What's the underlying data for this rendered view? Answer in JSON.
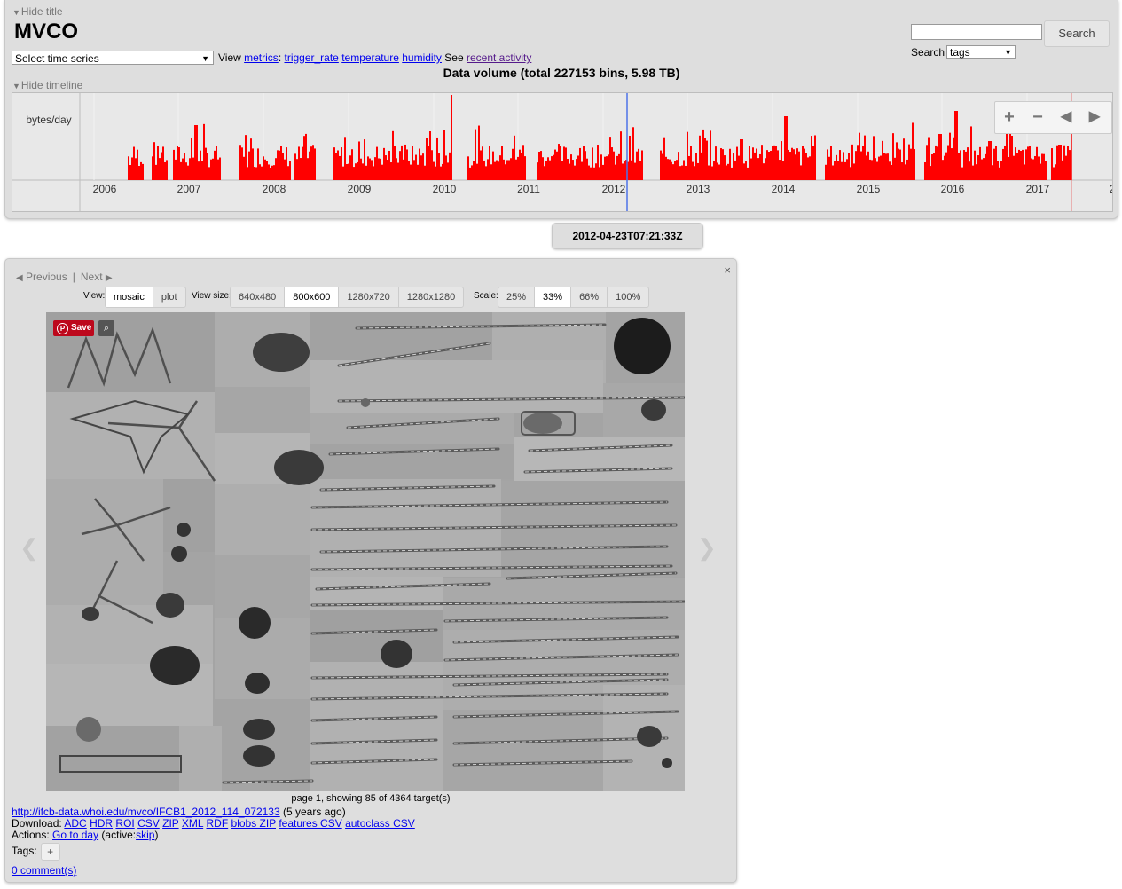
{
  "header": {
    "hide_title_label": "Hide title",
    "title": "MVCO",
    "time_series_select": "Select time series",
    "view_text": "View",
    "metrics_link": "metrics",
    "trigger_rate_link": "trigger_rate",
    "temperature_link": "temperature",
    "humidity_link": "humidity",
    "see_text": "See",
    "recent_activity_link": "recent activity",
    "volume_title": "Data volume (total 227153 bins, 5.98 TB)",
    "search_button": "Search",
    "search_input_value": "",
    "search_label": "Search",
    "search_select_value": "tags",
    "hide_timeline_label": "Hide timeline"
  },
  "timeline": {
    "y_label": "bytes/day",
    "years": [
      "2006",
      "2007",
      "2008",
      "2009",
      "2010",
      "2011",
      "2012",
      "2013",
      "2014",
      "2015",
      "2016",
      "2017",
      "2"
    ],
    "cursor_date": "2012-04-23",
    "bar_color": "#ff0000",
    "cursor_color": "#4d73e8",
    "end_marker_color": "#e87a7a",
    "controls": {
      "zoom_in": "+",
      "zoom_out": "−",
      "back": "◀",
      "forward": "▶"
    }
  },
  "date_pill": "2012-04-23T07:21:33Z",
  "bin": {
    "close": "×",
    "previous": "Previous",
    "separator": "|",
    "next": "Next",
    "view_label": "View:",
    "view_options": [
      "mosaic",
      "plot"
    ],
    "view_active": "mosaic",
    "size_label": "View size:",
    "size_options": [
      "640x480",
      "800x600",
      "1280x720",
      "1280x1280"
    ],
    "size_active": "800x600",
    "scale_label": "Scale:",
    "scale_options": [
      "25%",
      "33%",
      "66%",
      "100%"
    ],
    "scale_active": "33%",
    "save_label": "Save",
    "page_info": "page 1, showing 85 of 4364 target(s)",
    "bin_url": "http://ifcb-data.whoi.edu/mvco/IFCB1_2012_114_072133",
    "bin_age": "(5 years ago)",
    "download_label": "Download:",
    "downloads": [
      "ADC",
      "HDR",
      "ROI",
      "CSV",
      "ZIP",
      "XML",
      "RDF",
      "blobs ZIP",
      "features CSV",
      "autoclass CSV"
    ],
    "actions_label": "Actions:",
    "go_to_day": "Go to day",
    "active_text": "(active:",
    "skip": "skip",
    "active_close": ")",
    "tags_label": "Tags:",
    "tags_add": "+",
    "comments": "0 comment(s)"
  }
}
